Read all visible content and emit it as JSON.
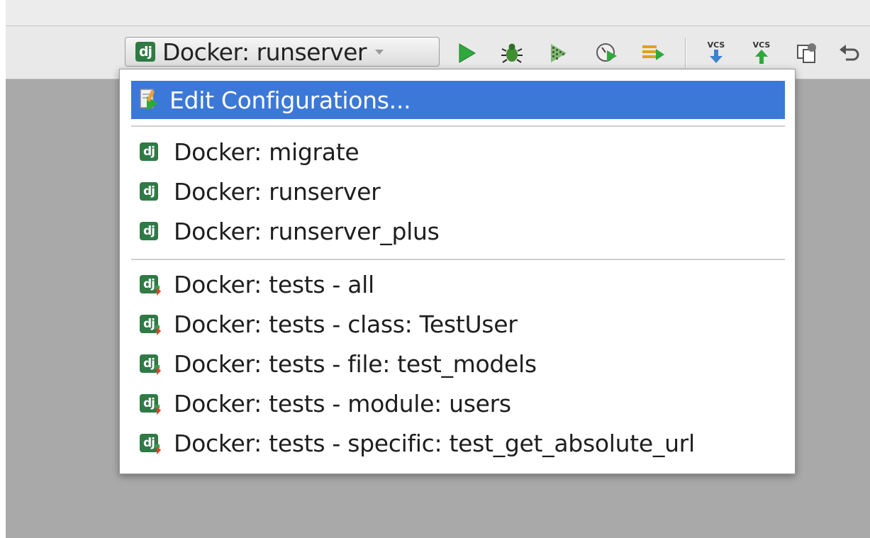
{
  "toolbar": {
    "run_config_label": "Docker: runserver",
    "buttons": [
      {
        "name": "run",
        "icon": "run-icon"
      },
      {
        "name": "debug",
        "icon": "debug-icon"
      },
      {
        "name": "coverage",
        "icon": "coverage-icon"
      },
      {
        "name": "profile",
        "icon": "profile-icon"
      },
      {
        "name": "concurrency",
        "icon": "concurrency-icon"
      },
      {
        "name": "vcs-update",
        "icon": "vcs-update-icon",
        "label": "VCS"
      },
      {
        "name": "vcs-commit",
        "icon": "vcs-commit-icon",
        "label": "VCS"
      },
      {
        "name": "compare",
        "icon": "compare-icon"
      },
      {
        "name": "revert",
        "icon": "undo-icon"
      }
    ],
    "vcs_update_label": "VCS",
    "vcs_commit_label": "VCS"
  },
  "popup": {
    "edit_label": "Edit Configurations...",
    "group_run": [
      {
        "label": "Docker: migrate",
        "icon": "django-icon"
      },
      {
        "label": "Docker: runserver",
        "icon": "django-icon"
      },
      {
        "label": "Docker: runserver_plus",
        "icon": "django-icon"
      }
    ],
    "group_tests": [
      {
        "label": "Docker: tests - all",
        "icon": "django-test-icon"
      },
      {
        "label": "Docker: tests - class: TestUser",
        "icon": "django-test-icon"
      },
      {
        "label": "Docker: tests - file: test_models",
        "icon": "django-test-icon"
      },
      {
        "label": "Docker: tests - module: users",
        "icon": "django-test-icon"
      },
      {
        "label": "Docker: tests - specific: test_get_absolute_url",
        "icon": "django-test-icon"
      }
    ],
    "icon_text": "dj"
  },
  "colors": {
    "selection": "#3b78d8",
    "django_green": "#2f7a45",
    "run_green": "#3cb043"
  }
}
